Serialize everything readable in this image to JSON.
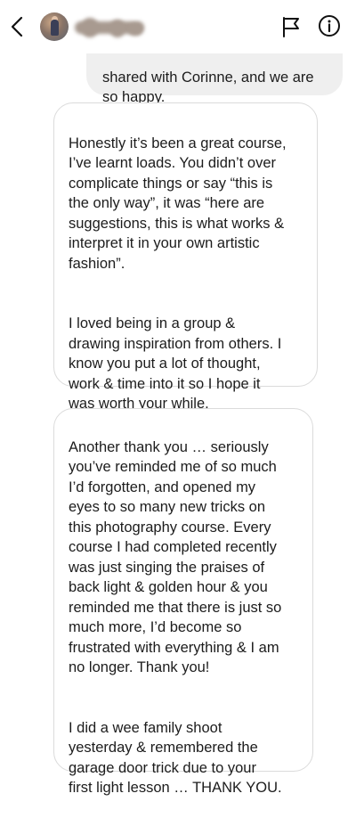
{
  "header": {
    "back_icon": "chevron-left-icon",
    "flag_icon": "flag-icon",
    "info_icon": "info-icon",
    "username_redacted": true
  },
  "messages": [
    {
      "direction": "outgoing",
      "text": "shared with Corinne, and we are\nso happy."
    },
    {
      "direction": "incoming",
      "paragraphs": [
        "Honestly it’s been a great course,\nI’ve learnt loads.  You didn’t over\ncomplicate things or say “this is\nthe only way”, it was “here are\nsuggestions, this is what works &\ninterpret it in your own artistic\nfashion”.",
        "I loved being in a group &\ndrawing inspiration from others.  I\nknow you put a lot of thought,\nwork & time into it so I hope it\nwas worth your while."
      ]
    },
    {
      "direction": "incoming",
      "paragraphs": [
        "Another thank you … seriously\nyou’ve reminded me of so much\nI’d forgotten, and opened my\neyes to so many new tricks on\nthis photography course.  Every\ncourse I had completed recently\nwas just singing the praises of\nback light & golden hour & you\nreminded me that there is just so\nmuch more, I’d become so\nfrustrated with everything & I am\nno longer.  Thank you!",
        "I did a wee family shoot\nyesterday & remembered the\ngarage door trick due to your\nfirst light lesson …  THANK YOU."
      ]
    }
  ],
  "colors": {
    "outgoing_bubble": "#efefef",
    "incoming_border": "#dbdbdb",
    "text": "#1c1c1c",
    "background": "#ffffff"
  }
}
